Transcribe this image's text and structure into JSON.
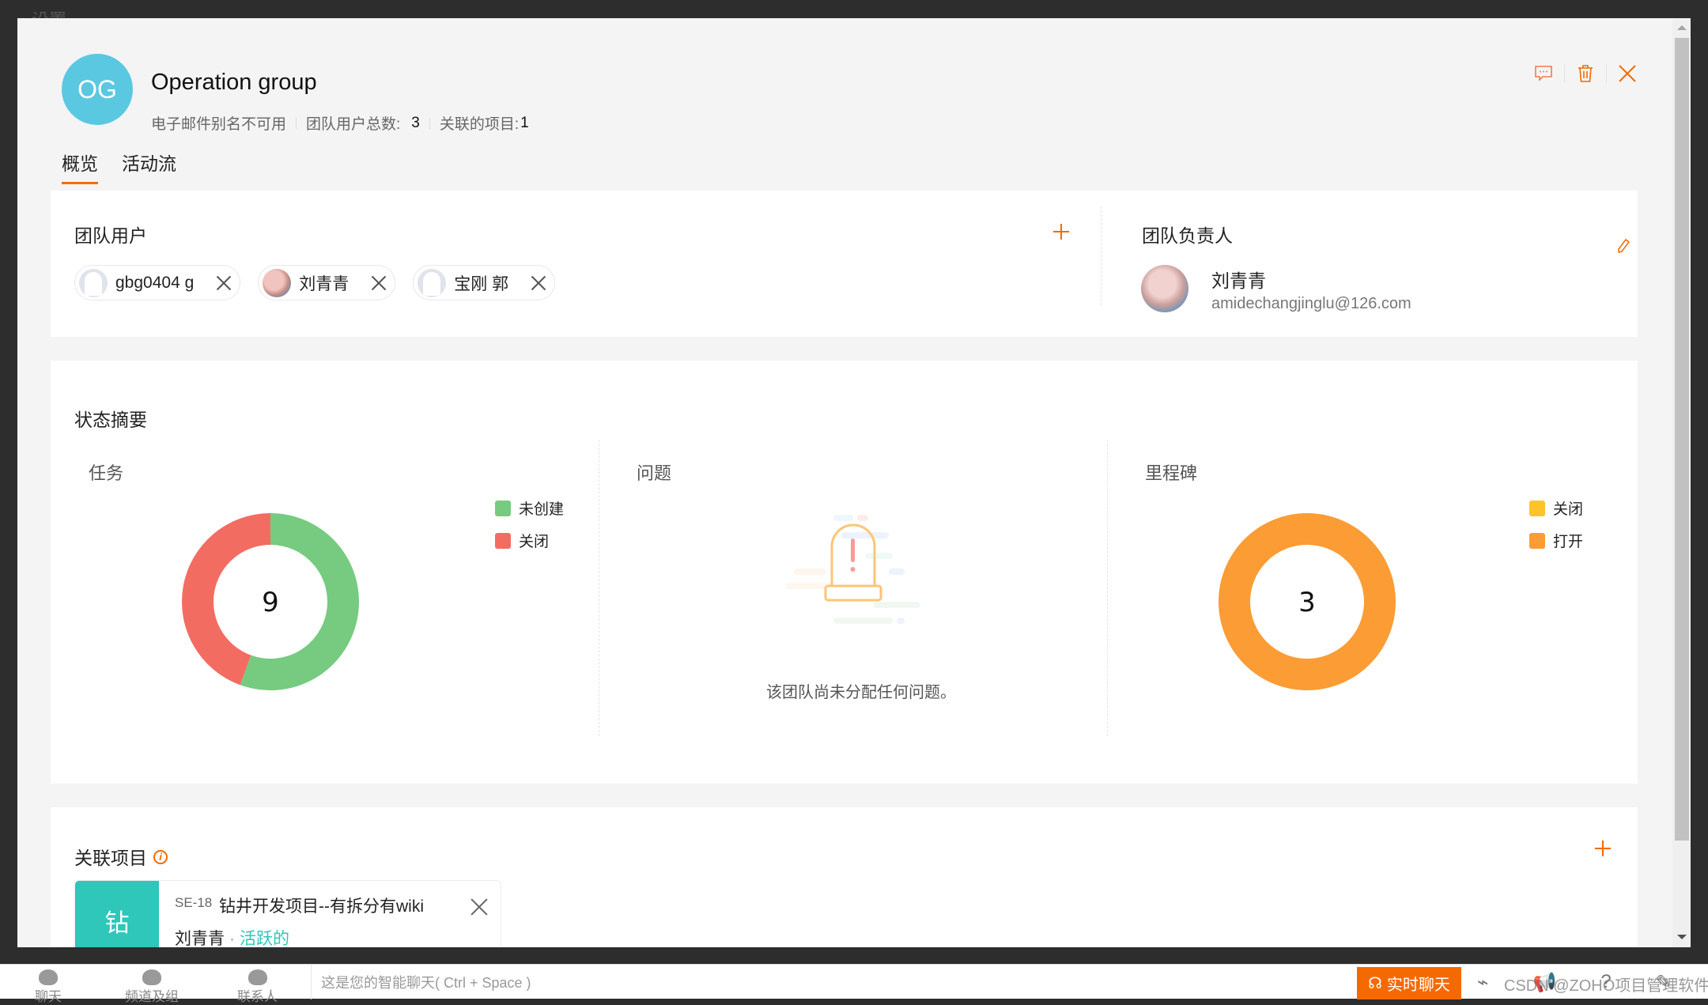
{
  "background": {
    "title": "设置"
  },
  "header": {
    "avatar_initials": "OG",
    "avatar_color": "#5bc8e2",
    "title": "Operation group",
    "email_alias": "电子邮件别名不可用",
    "user_count_label": "团队用户总数:",
    "user_count": "3",
    "linked_projects_label": "关联的项目:",
    "linked_projects": "1",
    "actions": [
      {
        "name": "comment-icon"
      },
      {
        "name": "trash-icon"
      },
      {
        "name": "close-icon"
      }
    ]
  },
  "tabs": [
    {
      "label": "概览",
      "active": true
    },
    {
      "label": "活动流",
      "active": false
    }
  ],
  "team_users": {
    "title": "团队用户",
    "add_icon": "plus-icon",
    "members": [
      {
        "name": "gbg0404 g",
        "avatar": "default"
      },
      {
        "name": "刘青青",
        "avatar": "photo"
      },
      {
        "name": "宝刚 郭",
        "avatar": "default"
      }
    ]
  },
  "team_owner": {
    "title": "团队负责人",
    "name": "刘青青",
    "email": "amidechangjinglu@126.com",
    "edit_icon": "pencil-icon"
  },
  "status_summary": {
    "title": "状态摘要",
    "issues": {
      "title": "问题",
      "empty_message": "该团队尚未分配任何问题。"
    }
  },
  "chart_data": [
    {
      "type": "pie",
      "title": "任务",
      "center_label": "9",
      "categories": [
        "未创建",
        "关闭"
      ],
      "values": [
        5,
        4
      ],
      "colors": [
        "#76cb80",
        "#f36c62"
      ],
      "legend": "right"
    },
    {
      "type": "pie",
      "title": "里程碑",
      "center_label": "3",
      "categories": [
        "关闭",
        "打开"
      ],
      "values": [
        0,
        3
      ],
      "colors": [
        "#fdc32a",
        "#fb9c34"
      ],
      "legend": "right"
    }
  ],
  "linked_projects": {
    "title": "关联项目",
    "info_icon": "info-icon",
    "add_icon": "plus-icon",
    "items": [
      {
        "badge": "钻",
        "badge_color": "#2ec7b9",
        "key": "SE-18",
        "name": "钻井开发项目--有拆分有wiki",
        "owner": "刘青青",
        "separator": "·",
        "status": "活跃的"
      }
    ]
  },
  "bottom_bar": {
    "nav": [
      {
        "label": "聊天",
        "icon": "chat-icon"
      },
      {
        "label": "频道及组",
        "icon": "channels-icon"
      },
      {
        "label": "联系人",
        "icon": "contacts-icon"
      }
    ],
    "search_placeholder": "这是您的智能聊天( Ctrl + Space )",
    "live_chat_label": "实时聊天",
    "watermark": "CSDN @ZOHO项目管理软件"
  },
  "accent_color": "#f56a00"
}
